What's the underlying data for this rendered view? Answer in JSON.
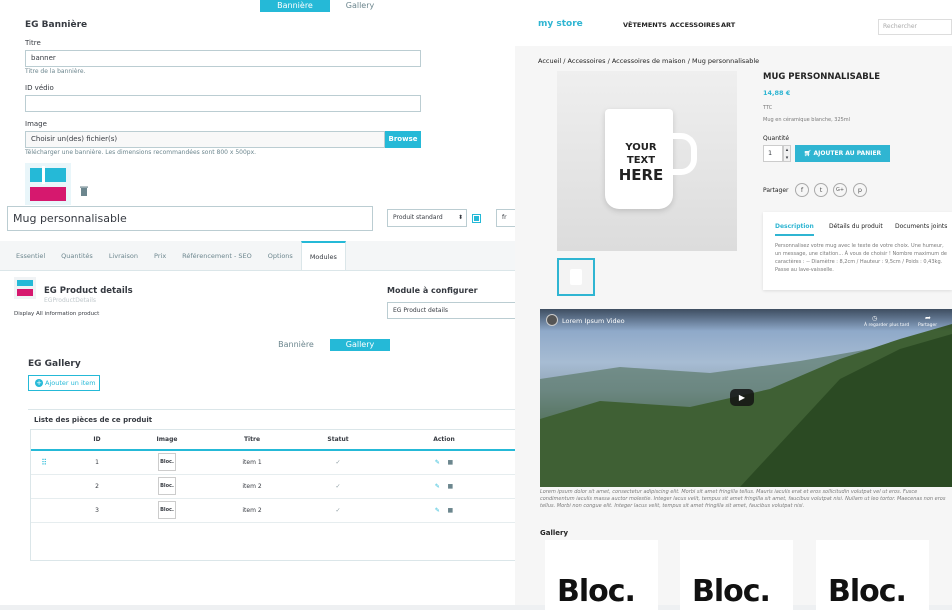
{
  "admin": {
    "banner_tabs": [
      "Bannière",
      "Gallery"
    ],
    "banner_title": "EG Bannière",
    "titre_label": "Titre",
    "titre_value": "banner",
    "titre_help": "Titre de la bannière.",
    "video_label": "ID védio",
    "image_label": "Image",
    "file_placeholder": "Choisir un(des) fichier(s)",
    "browse_label": "Browse",
    "image_help": "Télécharger une bannière. Les dimensions recommandées sont 800 x 500px.",
    "product_name": "Mug personnalisable",
    "product_type": "Produit standard",
    "lang": "fr",
    "product_tabs": [
      "Essentiel",
      "Quantités",
      "Livraison",
      "Prix",
      "Référencement - SEO",
      "Options",
      "Modules"
    ],
    "module_name": "EG Product details",
    "module_sub": "Display All information product",
    "module_ver": "EGProductDetails",
    "configure_label": "Module à configurer",
    "configure_value": "EG Product details",
    "gallery_tabs": [
      "Bannière",
      "Gallery"
    ],
    "gallery_title": "EG Gallery",
    "add_item_label": "Ajouter un item",
    "list_title": "Liste des pièces de ce produit",
    "table_headers": [
      "ID",
      "Image",
      "Titre",
      "Statut",
      "Action"
    ],
    "rows": [
      {
        "id": "1",
        "image": "Bloc.",
        "titre": "item 1"
      },
      {
        "id": "2",
        "image": "Bloc.",
        "titre": "item 2"
      },
      {
        "id": "3",
        "image": "Bloc.",
        "titre": "item 2"
      }
    ]
  },
  "store": {
    "logo": "my store",
    "nav": [
      "VÊTEMENTS",
      "ACCESSOIRES",
      "ART"
    ],
    "search_placeholder": "Rechercher",
    "breadcrumb": [
      "Accueil",
      "Accessoires",
      "Accessoires de maison",
      "Mug personnalisable"
    ],
    "product_title": "MUG PERSONNALISABLE",
    "price": "14,88 €",
    "tax": "TTC",
    "short_desc": "Mug en céramique blanche, 325ml",
    "qty_label": "Quantité",
    "qty_value": "1",
    "cart_label": "AJOUTER AU PANIER",
    "share_label": "Partager",
    "mug_text": [
      "YOUR TEXT",
      "HERE"
    ],
    "info_tabs": [
      "Description",
      "Détails du produit",
      "Documents joints"
    ],
    "description": "Personnalisez votre mug avec le texte de votre choix. Une humeur, un message, une citation... À vous de choisir ! Nombre maximum de caractères : -- Diamètre : 8,2cm / Hauteur : 9,5cm / Poids : 0,43kg. Passe au lave-vaisselle.",
    "video_title": "Lorem Ipsum Video",
    "video_watch": "À regarder plus tard",
    "video_share": "Partager",
    "video_caption": "Lorem ipsum dolor sit amet, consectetur adipiscing elit. Morbi sit amet fringilla tellus. Mauris iaculis erat et eros sollicitudin volutpat vel ut eros. Fusce condimentum iaculis massa auctor molestie. Integer lacus velit, tempus sit amet fringilla sit amet, faucibus volutpat nisi. Nullam ut leo tortor. Maecenas non eros tellus. Morbi non congue elit. Integer lacus velit, tempus sit amet fringilla sit amet, faucibus volutpat nisi.",
    "gallery_title": "Gallery",
    "gallery_items": [
      "Bloc.",
      "Bloc.",
      "Bloc."
    ]
  },
  "colors": {
    "accent": "#25b9d7",
    "store_accent": "#2fb5d2"
  }
}
